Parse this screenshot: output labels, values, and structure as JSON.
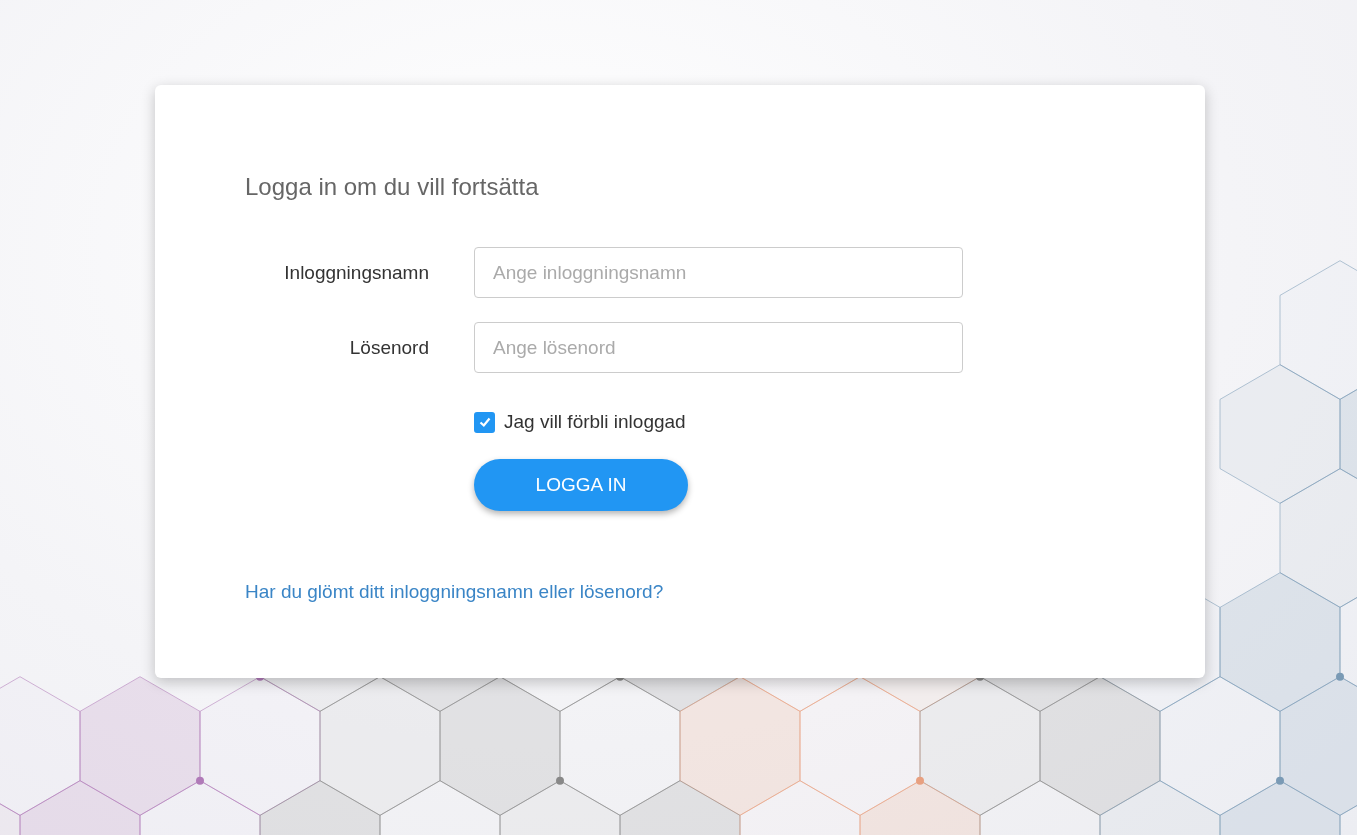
{
  "title": "Logga in om du vill fortsätta",
  "fields": [
    {
      "label": "Inloggningsnamn",
      "placeholder": "Ange inloggningsnamn"
    },
    {
      "label": "Lösenord",
      "placeholder": "Ange lösenord"
    }
  ],
  "remember": {
    "label": "Jag vill förbli inloggad",
    "checked": true
  },
  "button": "LOGGA IN",
  "forgot_link": "Har du glömt ditt inloggningsnamn eller lösenord?"
}
